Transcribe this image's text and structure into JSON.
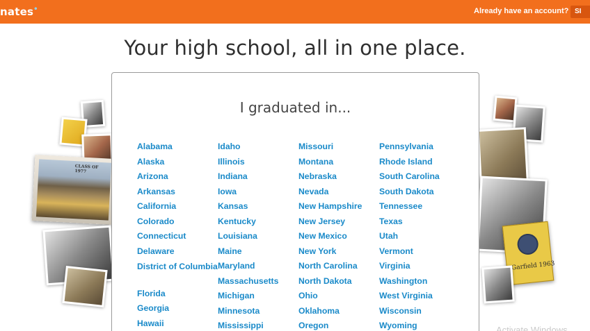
{
  "header": {
    "logo": "nates",
    "account_prompt": "Already have an account?",
    "signin_label": "SI",
    "colors": {
      "bar": "#f26f1d",
      "button": "#d8560f"
    }
  },
  "headline": "Your high school, all in one place.",
  "card": {
    "title": "I graduated in...",
    "link_color": "#1a8ac9",
    "columns": [
      [
        "Alabama",
        "Alaska",
        "Arizona",
        "Arkansas",
        "California",
        "Colorado",
        "Connecticut",
        "Delaware",
        "District of Columbia",
        "Florida",
        "Georgia",
        "Hawaii"
      ],
      [
        "Idaho",
        "Illinois",
        "Indiana",
        "Iowa",
        "Kansas",
        "Kentucky",
        "Louisiana",
        "Maine",
        "Maryland",
        "Massachusetts",
        "Michigan",
        "Minnesota",
        "Mississippi"
      ],
      [
        "Missouri",
        "Montana",
        "Nebraska",
        "Nevada",
        "New Hampshire",
        "New Jersey",
        "New Mexico",
        "New York",
        "North Carolina",
        "North Dakota",
        "Ohio",
        "Oklahoma",
        "Oregon"
      ],
      [
        "Pennsylvania",
        "Rhode Island",
        "South Carolina",
        "South Dakota",
        "Tennessee",
        "Texas",
        "Utah",
        "Vermont",
        "Virginia",
        "Washington",
        "West Virginia",
        "Wisconsin",
        "Wyoming"
      ]
    ]
  },
  "collage": {
    "yearbook_left_caption": "CLASS OF 1977",
    "yearbook_right_caption": "Garfield 1963"
  },
  "watermark": "Activate Windows"
}
